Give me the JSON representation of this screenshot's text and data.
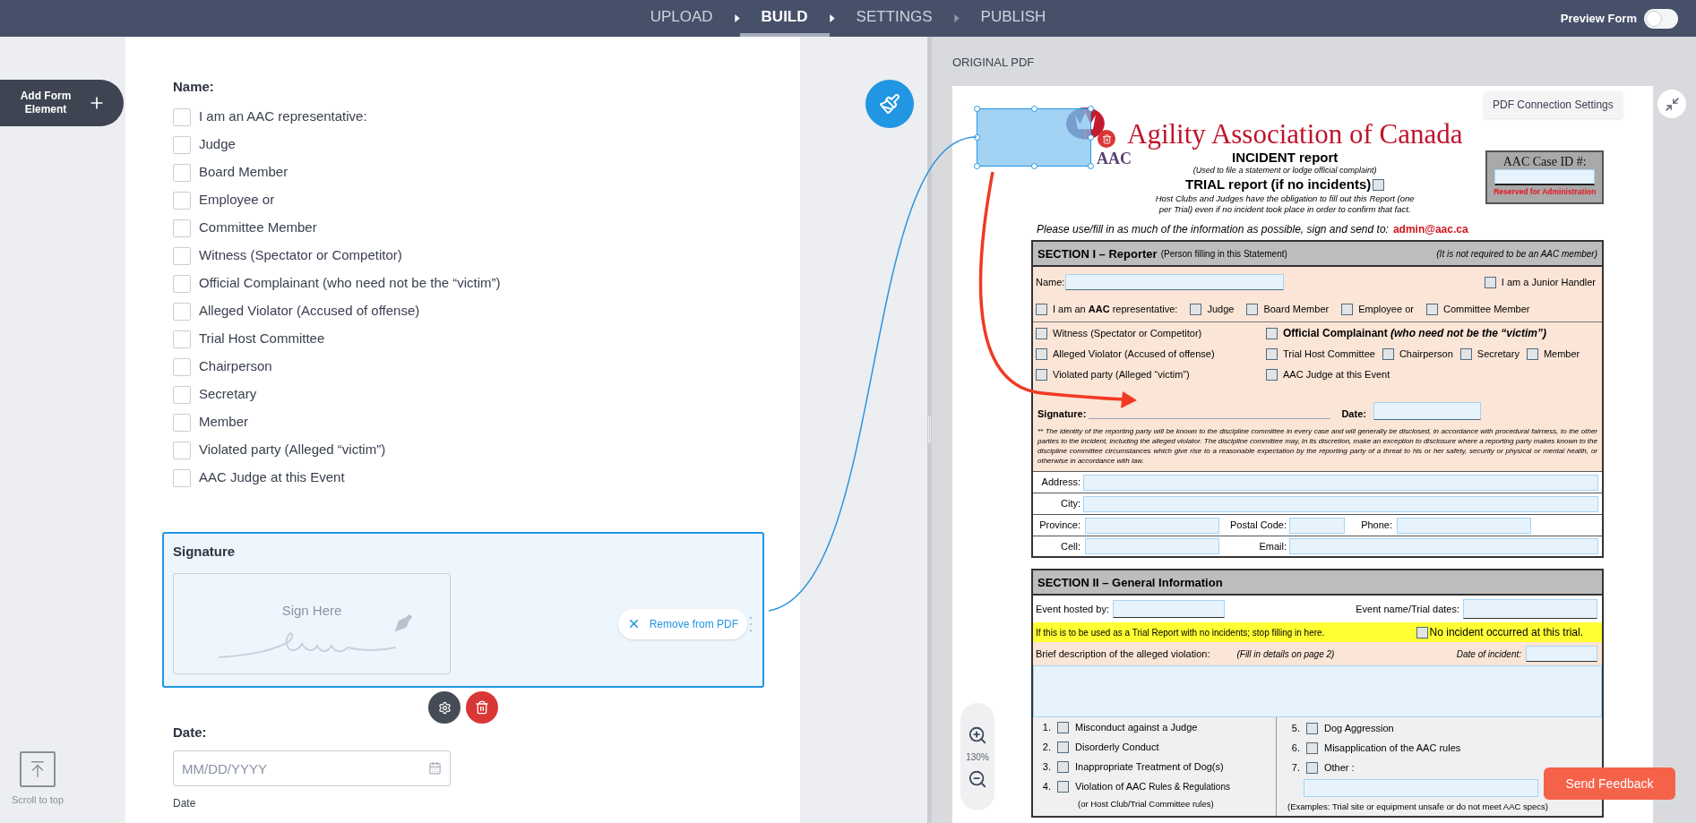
{
  "nav": {
    "steps": [
      {
        "label": "UPLOAD",
        "selected": false
      },
      {
        "label": "BUILD",
        "selected": true
      },
      {
        "label": "SETTINGS",
        "selected": false
      },
      {
        "label": "PUBLISH",
        "selected": false
      }
    ],
    "preview": {
      "label": "Preview Form",
      "on": false
    }
  },
  "sidebar": {
    "add_button": "Add Form Element",
    "scroll_top": "Scroll to top"
  },
  "form": {
    "elements": [
      {
        "kind": "checkbox_group",
        "label": "Name:",
        "options": [
          {
            "label": "I am an AAC representative:",
            "checked": false
          },
          {
            "label": "Judge",
            "checked": false
          },
          {
            "label": "Board Member",
            "checked": false
          },
          {
            "label": "Employee or",
            "checked": false
          },
          {
            "label": "Committee Member",
            "checked": false
          },
          {
            "label": "Witness (Spectator or Competitor)",
            "checked": false
          },
          {
            "label": "Official Complainant (who need not be the “victim”)",
            "checked": false
          },
          {
            "label": "Alleged Violator (Accused of offense)",
            "checked": false
          },
          {
            "label": "Trial Host Committee",
            "checked": false
          },
          {
            "label": "Chairperson",
            "checked": false
          },
          {
            "label": "Secretary",
            "checked": false
          },
          {
            "label": "Member",
            "checked": false
          },
          {
            "label": "Violated party (Alleged “victim”)",
            "checked": false
          },
          {
            "label": "AAC Judge at this Event",
            "checked": false
          }
        ]
      },
      {
        "kind": "signature",
        "label": "Signature",
        "placeholder": "Sign Here",
        "remove_label": "Remove from PDF",
        "selected": true
      },
      {
        "kind": "date",
        "label": "Date:",
        "placeholder": "MM/DD/YYYY",
        "help": "Date"
      }
    ]
  },
  "pdf_panel": {
    "title": "ORIGINAL PDF",
    "connection_button": "PDF Connection Settings",
    "zoom": "130%",
    "feedback_button": "Send Feedback",
    "document": {
      "header": {
        "logo_text": "AAC",
        "title": "Agility Association of Canada",
        "subtitle": "INCIDENT report",
        "subtitle_note": "(Used to file a statement or lodge official complaint)",
        "trial_label": "TRIAL report (if no incidents)",
        "trial_checked": false,
        "host_note": "Host Clubs and Judges have the obligation to fill out this Report (one per Trial) even if no incident took place in order to confirm that fact.",
        "case_label": "AAC Case ID #:",
        "case_note": "Reserved for Administration",
        "instruction": "Please use/fill in as much of the information as possible, sign and send to:",
        "email": "admin@aac.ca"
      },
      "section1": {
        "title": "SECTION I – Reporter",
        "title_note": "(Person filling in this Statement)",
        "aside": "(It is not required to be an AAC member)",
        "name_label": "Name:",
        "junior": {
          "label": "I am a Junior Handler",
          "checked": false
        },
        "roles": [
          {
            "label": "I am an **AAC** representative:",
            "checked": false
          },
          {
            "label": "Judge",
            "checked": false
          },
          {
            "label": "Board Member",
            "checked": false
          },
          {
            "label": "Employee or",
            "checked": false
          },
          {
            "label": "Committee Member",
            "checked": false
          }
        ],
        "left_roles": [
          {
            "label": "Witness (Spectator or Competitor)",
            "checked": false
          },
          {
            "label": "Alleged Violator (Accused of offense)",
            "checked": false
          },
          {
            "label": "Violated party (Alleged “victim”)",
            "checked": false
          }
        ],
        "complainant": {
          "label": "Official Complainant *(who need not be the “victim”)*",
          "checked": false
        },
        "host_roles": [
          {
            "label": "Trial Host Committee",
            "checked": false
          },
          {
            "label": "Chairperson",
            "checked": false
          },
          {
            "label": "Secretary",
            "checked": false
          },
          {
            "label": "Member",
            "checked": false
          }
        ],
        "judge_role": {
          "label": "AAC Judge at this Event",
          "checked": false
        },
        "signature_label": "Signature:",
        "date_label": "Date:",
        "footnote": "** The identity of the reporting party will be known to the discipline committee in every case and will generally be disclosed, in accordance with procedural fairness, to the other parties to the incident, including the alleged violator. The discipline committee may, in its discretion, make an exception to disclosure where a reporting party makes known to the discipline committee circumstances which give rise to a reasonable expectation by the reporting party of a threat to his or her safety, security or physical or mental health, or otherwise in accordance with law.",
        "contact": {
          "address": "Address:",
          "city": "City:",
          "province": "Province:",
          "postal": "Postal Code:",
          "phone": "Phone:",
          "cell": "Cell:",
          "email": "Email:"
        }
      },
      "section2": {
        "title": "SECTION II – General Information",
        "hosted_label": "Event hosted by:",
        "event_label": "Event name/Trial dates:",
        "trial_note": "If this is to be used as a Trial Report with no incidents; stop filling in here.",
        "no_incident": {
          "label": "No incident occurred at this trial.",
          "checked": false
        },
        "brief_label": "Brief description of the alleged violation:",
        "brief_note": "(Fill in details on page 2)",
        "incident_date_label": "Date of incident:",
        "violations": [
          {
            "kind": "plain",
            "number": "1.",
            "label": "Misconduct against a Judge",
            "checked": false
          },
          {
            "kind": "plain",
            "number": "2.",
            "label": "Disorderly Conduct",
            "checked": false
          },
          {
            "kind": "plain",
            "number": "3.",
            "label": "Inappropriate Treatment of Dog(s)",
            "checked": false
          },
          {
            "kind": "noted",
            "number": "4.",
            "label": "Violation of AAC",
            "small": "Rules & Regulations",
            "note": "(or Host Club/Trial Committee rules)",
            "checked": false
          },
          {
            "kind": "plain",
            "number": "5.",
            "label": "Dog Aggression",
            "checked": false
          },
          {
            "kind": "plain",
            "number": "6.",
            "label": "Misapplication of the AAC rules",
            "checked": false
          },
          {
            "kind": "other",
            "number": "7.",
            "label": "Other :",
            "note": "(Examples: Trial site or equipment unsafe or do not meet AAC specs)",
            "checked": false
          }
        ]
      }
    }
  }
}
